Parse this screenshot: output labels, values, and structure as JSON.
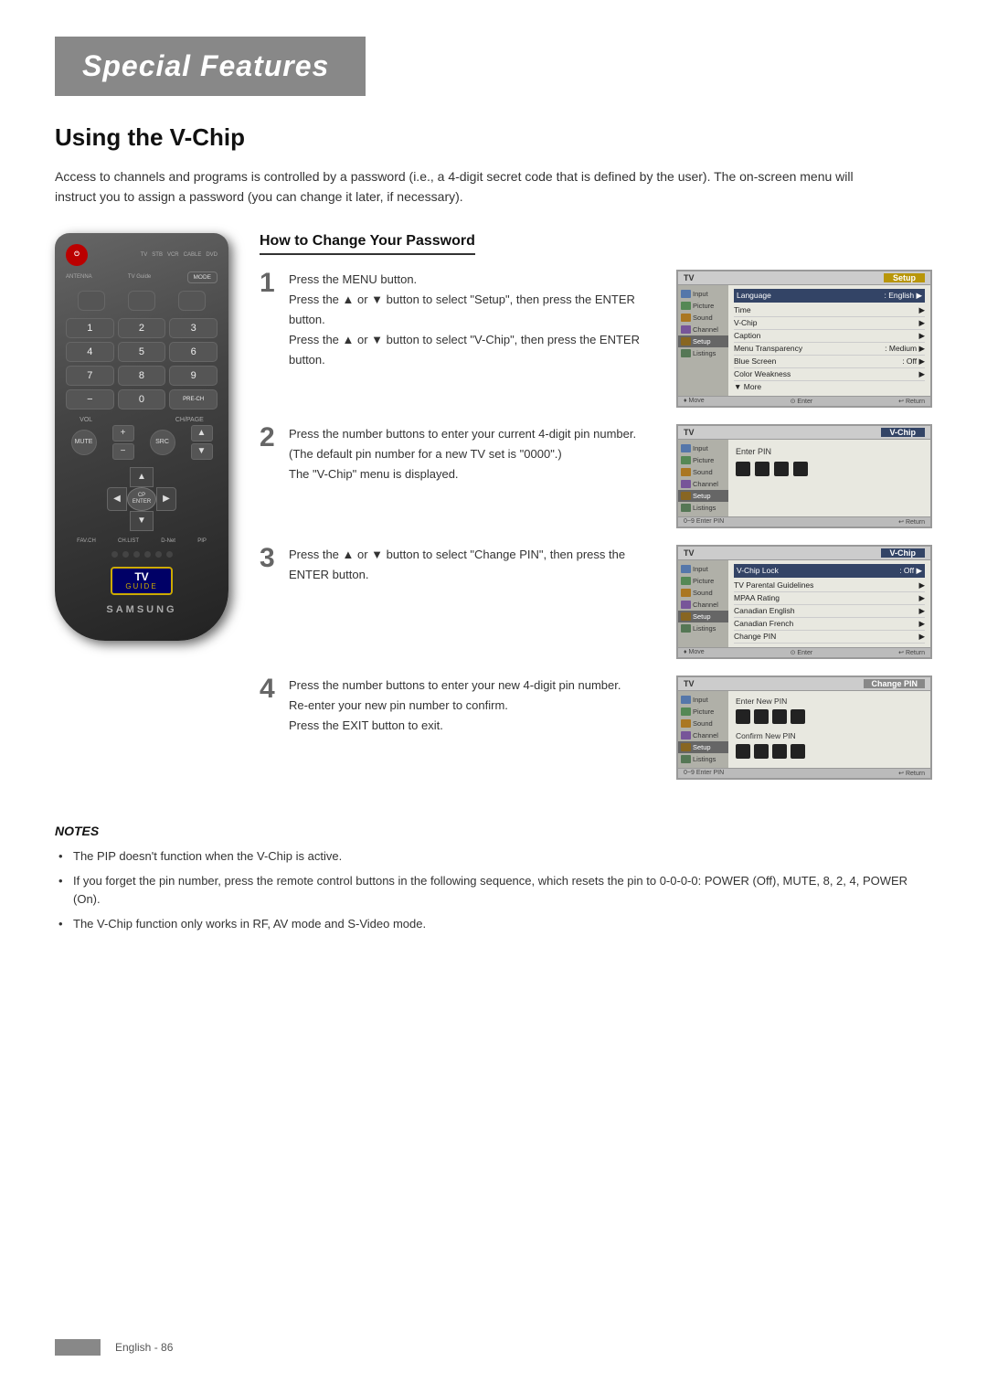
{
  "page": {
    "header_title": "Special Features",
    "section_title": "Using the V-Chip",
    "intro_text": "Access to channels and programs is controlled by a password (i.e., a 4-digit secret code that is defined by the user). The on-screen menu will instruct you to assign a password (you can change it later, if necessary).",
    "how_to_title": "How to Change Your Password",
    "footer_text": "English - 86"
  },
  "steps": [
    {
      "num": "1",
      "text_parts": [
        "Press the MENU button.",
        "Press the ▲ or ▼ button to select \"Setup\", then press the ENTER button.",
        "Press the ▲ or ▼ button to select \"V-Chip\", then press the ENTER button."
      ]
    },
    {
      "num": "2",
      "text_parts": [
        "Press the number buttons to enter your current 4-digit pin number.",
        "(The default pin number for a new TV set is \"0000\".)",
        "The \"V-Chip\" menu is displayed."
      ]
    },
    {
      "num": "3",
      "text_parts": [
        "Press the ▲ or ▼ button to select \"Change PIN\", then press the ENTER button."
      ]
    },
    {
      "num": "4",
      "text_parts": [
        "Press the number buttons to enter your new 4-digit pin number.",
        "Re-enter your new pin number to confirm.",
        "Press the EXIT button to exit."
      ]
    }
  ],
  "screens": [
    {
      "id": "setup",
      "tv_label": "TV",
      "menu_label": "Setup",
      "menu_style": "gold",
      "sidebar_items": [
        "Input",
        "Picture",
        "Sound",
        "Channel",
        "Setup",
        "Listings"
      ],
      "active_sidebar": "Setup",
      "menu_items": [
        {
          "label": "Language",
          "value": ": English",
          "has_arrow": true
        },
        {
          "label": "Time",
          "value": "",
          "has_arrow": true
        },
        {
          "label": "V-Chip",
          "value": "",
          "has_arrow": true
        },
        {
          "label": "Caption",
          "value": "",
          "has_arrow": true
        },
        {
          "label": "Menu Transparency",
          "value": ": Medium",
          "has_arrow": true
        },
        {
          "label": "Blue Screen",
          "value": ": Off",
          "has_arrow": true
        },
        {
          "label": "Color Weakness",
          "value": "",
          "has_arrow": true
        },
        {
          "label": "▼ More",
          "value": "",
          "has_arrow": false
        }
      ],
      "footer": "♦ Move  ⓔ Enter  ↩ Return"
    },
    {
      "id": "vchip-pin",
      "tv_label": "TV",
      "menu_label": "V-Chip",
      "menu_style": "blue",
      "sidebar_items": [
        "Input",
        "Picture",
        "Sound",
        "Channel",
        "Setup",
        "Listings"
      ],
      "active_sidebar": "Setup",
      "enter_pin_label": "Enter PIN",
      "footer": "0~9 Enter PIN  ↩ Return"
    },
    {
      "id": "vchip-menu",
      "tv_label": "TV",
      "menu_label": "V-Chip",
      "menu_style": "blue",
      "sidebar_items": [
        "Input",
        "Picture",
        "Sound",
        "Channel",
        "Setup",
        "Listings"
      ],
      "active_sidebar": "Setup",
      "menu_items": [
        {
          "label": "V-Chip Lock",
          "value": ": Off",
          "has_arrow": true
        },
        {
          "label": "TV Parental Guidelines",
          "value": "",
          "has_arrow": true
        },
        {
          "label": "MPAA Rating",
          "value": "",
          "has_arrow": true
        },
        {
          "label": "Canadian English",
          "value": "",
          "has_arrow": true
        },
        {
          "label": "Canadian French",
          "value": "",
          "has_arrow": true
        },
        {
          "label": "Change PIN",
          "value": "",
          "has_arrow": true
        }
      ],
      "footer": "♦ Move  ⓔ Enter  ↩ Return"
    },
    {
      "id": "change-pin",
      "tv_label": "TV",
      "menu_label": "Change PIN",
      "menu_style": "gray",
      "sidebar_items": [
        "Input",
        "Picture",
        "Sound",
        "Channel",
        "Setup",
        "Listings"
      ],
      "active_sidebar": "Setup",
      "enter_new_pin_label": "Enter New PIN",
      "confirm_pin_label": "Confirm New PIN",
      "footer": "0~9 Enter PIN  ↩ Return"
    }
  ],
  "notes": {
    "title": "NOTES",
    "items": [
      "The PIP doesn't function when the V-Chip is active.",
      "If you forget the pin number, press the remote control buttons in the following sequence, which resets the pin to 0-0-0-0: POWER (Off), MUTE, 8, 2, 4, POWER (On).",
      "The V-Chip function only works in RF, AV mode and S-Video mode."
    ]
  },
  "remote": {
    "power_label": "POWER",
    "source_labels": [
      "TV",
      "STB",
      "VCR",
      "CABLE",
      "DVD"
    ],
    "antenna_label": "ANTENNA",
    "tv_guide_label": "TV Guide",
    "mode_label": "MODE",
    "numpad": [
      "1",
      "2",
      "3",
      "4",
      "5",
      "6",
      "7",
      "8",
      "9",
      "−",
      "0",
      "PRE-CH"
    ],
    "vol_label": "VOL",
    "chpage_label": "CH/PAGE",
    "mute_label": "MUTE",
    "source_label": "SOURCE",
    "dpad_labels": {
      "up": "▲",
      "down": "▼",
      "left": "◀",
      "right": "▶",
      "center": "CP\nENTER"
    },
    "bottom_labels": [
      "FAV.CH",
      "CH.LIST",
      "D-Net",
      "PIP"
    ],
    "tv_guide_logo": "TV\nGUIDE",
    "samsung_label": "SAMSUNG"
  }
}
